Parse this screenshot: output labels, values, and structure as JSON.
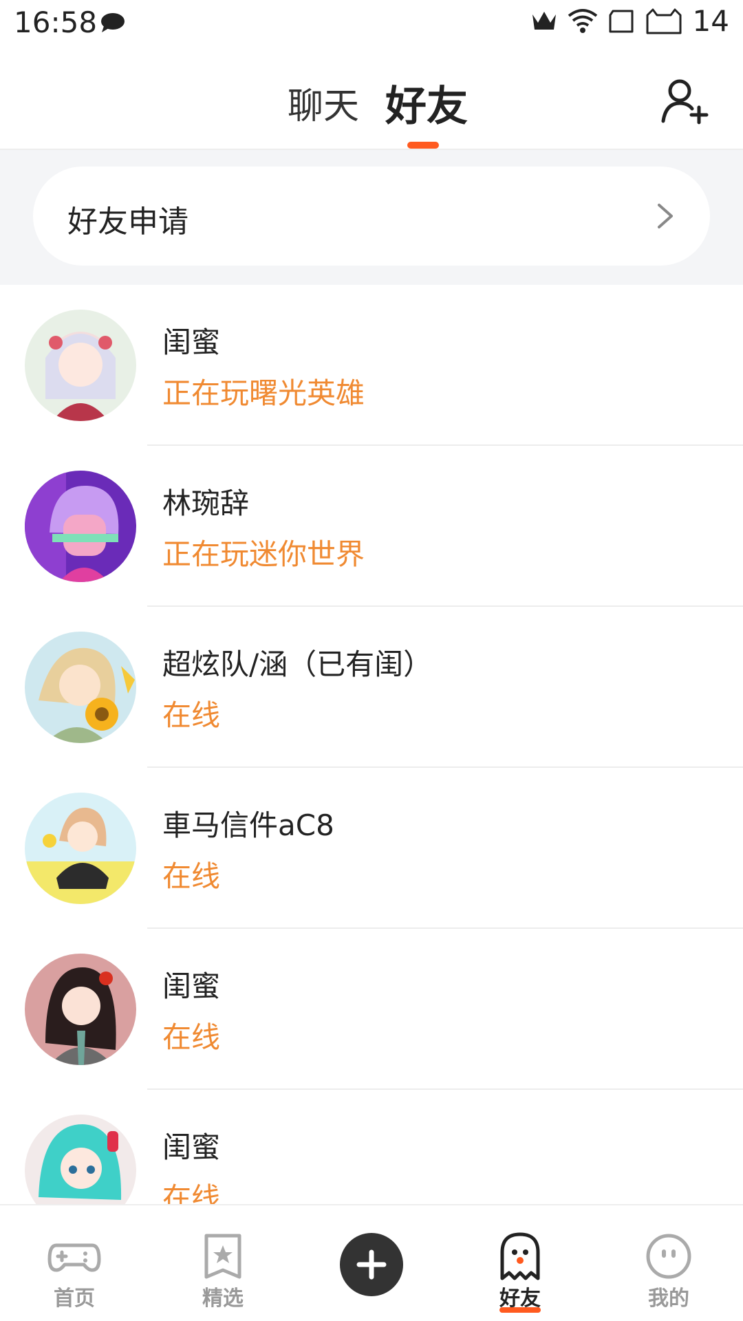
{
  "status_bar": {
    "time": "16:58",
    "battery": "14"
  },
  "header": {
    "tabs": [
      {
        "label": "聊天",
        "active": false
      },
      {
        "label": "好友",
        "active": true
      }
    ]
  },
  "friend_request": {
    "label": "好友申请"
  },
  "friends": [
    {
      "name": "闺蜜",
      "status": "正在玩曙光英雄"
    },
    {
      "name": "林琬辞",
      "status": "正在玩迷你世界"
    },
    {
      "name": "超炫队/涵（已有闺）",
      "status": "在线"
    },
    {
      "name": "車马信件aC8",
      "status": "在线"
    },
    {
      "name": "闺蜜",
      "status": "在线"
    },
    {
      "name": "闺蜜",
      "status": "在线"
    }
  ],
  "bottom_nav": {
    "items": [
      {
        "label": "首页",
        "icon": "gamepad-icon"
      },
      {
        "label": "精选",
        "icon": "star-card-icon"
      },
      {
        "label": "好友",
        "icon": "ghost-icon",
        "active": true
      },
      {
        "label": "我的",
        "icon": "face-icon"
      }
    ],
    "create_icon": "plus-icon"
  },
  "colors": {
    "accent": "#ff5a1f",
    "status_text": "#f08a32",
    "create_button": "#333333"
  }
}
